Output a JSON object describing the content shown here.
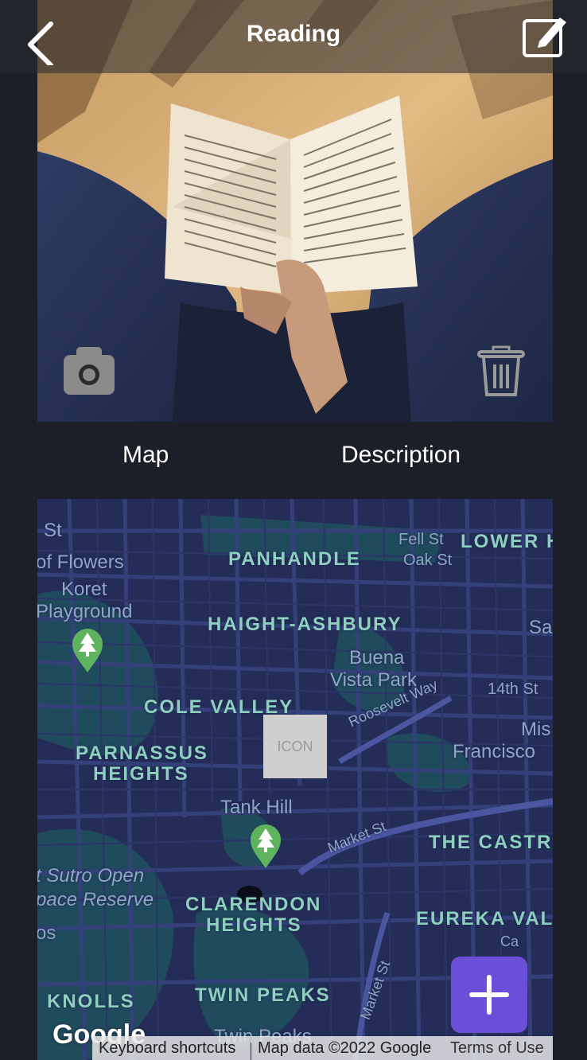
{
  "header": {
    "title": "Reading"
  },
  "icons": {
    "back": "chevron-left-icon",
    "edit": "edit-icon",
    "camera": "camera-icon",
    "trash": "trash-icon",
    "add": "plus-icon"
  },
  "tabs": {
    "map": "Map",
    "description": "Description"
  },
  "map": {
    "neighborhoods": [
      "PANHANDLE",
      "LOWER H",
      "HAIGHT-ASHBURY",
      "COLE VALLEY",
      "PARNASSUS",
      "HEIGHTS",
      "CLARENDON",
      "HEIGHTS",
      "THE CASTR",
      "EUREKA VAL",
      "TWIN PEAKS",
      "KNOLLS"
    ],
    "places": [
      "St",
      "of Flowers",
      "Koret",
      "Playground",
      "Fell St",
      "Oak St",
      "Sa",
      "Buena",
      "Vista Park",
      "14th St",
      "Roosevelt Way",
      "Mis",
      "Francisco",
      "Tank Hill",
      "Market St",
      "t Sutro Open",
      "pace Reserve",
      "os",
      "Ca",
      "Market St",
      "Twin Peaks"
    ],
    "marker_placeholder": "ICON",
    "google_logo": "Google",
    "attribution": {
      "keyboard": "Keyboard shortcuts",
      "data": "Map data ©2022 Google",
      "terms": "Terms of Use"
    }
  },
  "colors": {
    "background": "#1c1f27",
    "fab": "#6b4fd8",
    "map_bg": "#232c55",
    "park": "#1e4a5a"
  }
}
